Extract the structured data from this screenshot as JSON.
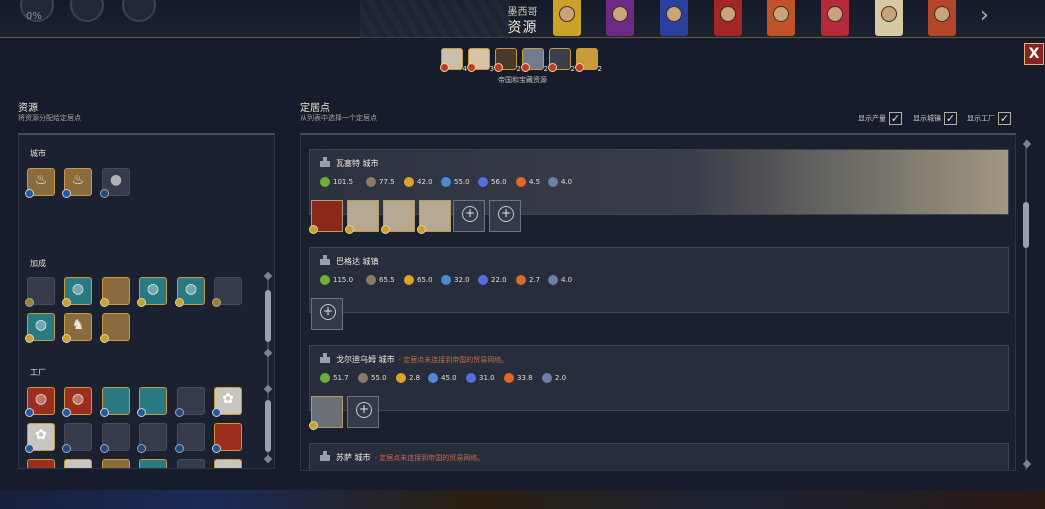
{
  "topbar": {
    "percent": "0%",
    "nation": "墨西哥",
    "title": "资源"
  },
  "close_label": "X",
  "summary": {
    "label": "帝国和宝藏资源",
    "items": [
      {
        "icon": "cotton-icon",
        "count": "4"
      },
      {
        "icon": "wool-icon",
        "count": "3"
      },
      {
        "icon": "horse-icon",
        "count": "2"
      },
      {
        "icon": "porcelain-icon",
        "count": "2"
      },
      {
        "icon": "iron-icon",
        "count": "2"
      },
      {
        "icon": "gold-icon",
        "count": "2"
      }
    ]
  },
  "left": {
    "title": "资源",
    "subtitle": "将资源分配给定居点",
    "groups": {
      "city": "城市",
      "bonus": "加成",
      "factory": "工厂"
    }
  },
  "right": {
    "title": "定居点",
    "subtitle": "从列表中选择一个定居点",
    "toggles": {
      "production": "显示产量",
      "towns": "显示城镇",
      "factories": "显示工厂"
    },
    "settlements": [
      {
        "name": "瓦塞特 城市",
        "warning": "",
        "stats": [
          "101.5",
          "77.5",
          "42.0",
          "55.0",
          "56.0",
          "4.5",
          "4.0"
        ]
      },
      {
        "name": "巴格达 城镇",
        "warning": "",
        "stats": [
          "115.0",
          "65.5",
          "65.0",
          "32.0",
          "22.0",
          "2.7",
          "4.0"
        ]
      },
      {
        "name": "戈尔迪乌姆 城市",
        "warning": "- 定居点未连接到帝国的贸易网络。",
        "stats": [
          "51.7",
          "55.0",
          "2.8",
          "45.0",
          "31.0",
          "33.8",
          "2.0"
        ]
      },
      {
        "name": "苏萨 城市",
        "warning": "- 定居点未连接到帝国的贸易网络。",
        "stats": []
      }
    ]
  },
  "colors": {
    "gold_border": "#c99a39",
    "warning": "#c86a4b",
    "close_bg": "#8a2121"
  }
}
